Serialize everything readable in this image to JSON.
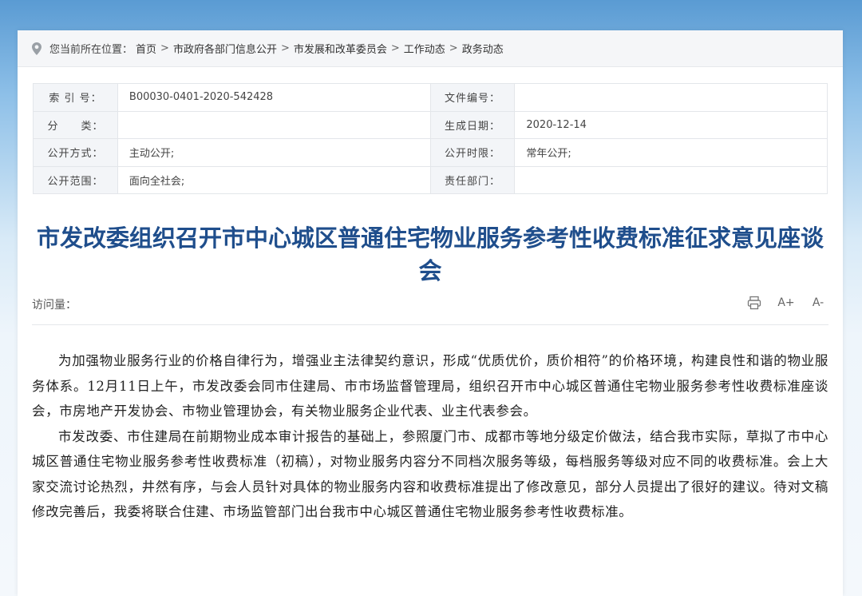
{
  "breadcrumb": {
    "label": "您当前所在位置：",
    "items": [
      "首页",
      "市政府各部门信息公开",
      "市发展和改革委员会",
      "工作动态",
      "政务动态"
    ],
    "separator": ">"
  },
  "meta": {
    "index_label": "索 引 号：",
    "index_value": "B00030-0401-2020-542428",
    "docno_label": "文件编号：",
    "docno_value": "",
    "category_label": "分　　类：",
    "category_value": "",
    "date_label": "生成日期：",
    "date_value": "2020-12-14",
    "mode_label": "公开方式：",
    "mode_value": "主动公开;",
    "period_label": "公开时限：",
    "period_value": "常年公开;",
    "scope_label": "公开范围：",
    "scope_value": "面向全社会;",
    "dept_label": "责任部门：",
    "dept_value": ""
  },
  "article": {
    "title": "市发改委组织召开市中心城区普通住宅物业服务参考性收费标准征求意见座谈会",
    "visits_label": "访问量：",
    "paragraphs": [
      "为加强物业服务行业的价格自律行为，增强业主法律契约意识，形成“优质优价，质价相符”的价格环境，构建良性和谐的物业服务体系。12月11日上午，市发改委会同市住建局、市市场监督管理局，组织召开市中心城区普通住宅物业服务参考性收费标准座谈会，市房地产开发协会、市物业管理协会，有关物业服务企业代表、业主代表参会。",
      "市发改委、市住建局在前期物业成本审计报告的基础上，参照厦门市、成都市等地分级定价做法，结合我市实际，草拟了市中心城区普通住宅物业服务参考性收费标准（初稿），对物业服务内容分不同档次服务等级，每档服务等级对应不同的收费标准。会上大家交流讨论热烈，井然有序，与会人员针对具体的物业服务内容和收费标准提出了修改意见，部分人员提出了很好的建议。待对文稿修改完善后，我委将联合住建、市场监管部门出台我市中心城区普通住宅物业服务参考性收费标准。"
    ]
  },
  "tools": {
    "font_larger": "A+",
    "font_smaller": "A-"
  },
  "icons": [
    "location-pin-icon",
    "print-icon",
    "font-increase-icon",
    "font-decrease-icon"
  ],
  "colors": {
    "title": "#1f4e8c",
    "background_top": "#5a9bd3"
  }
}
